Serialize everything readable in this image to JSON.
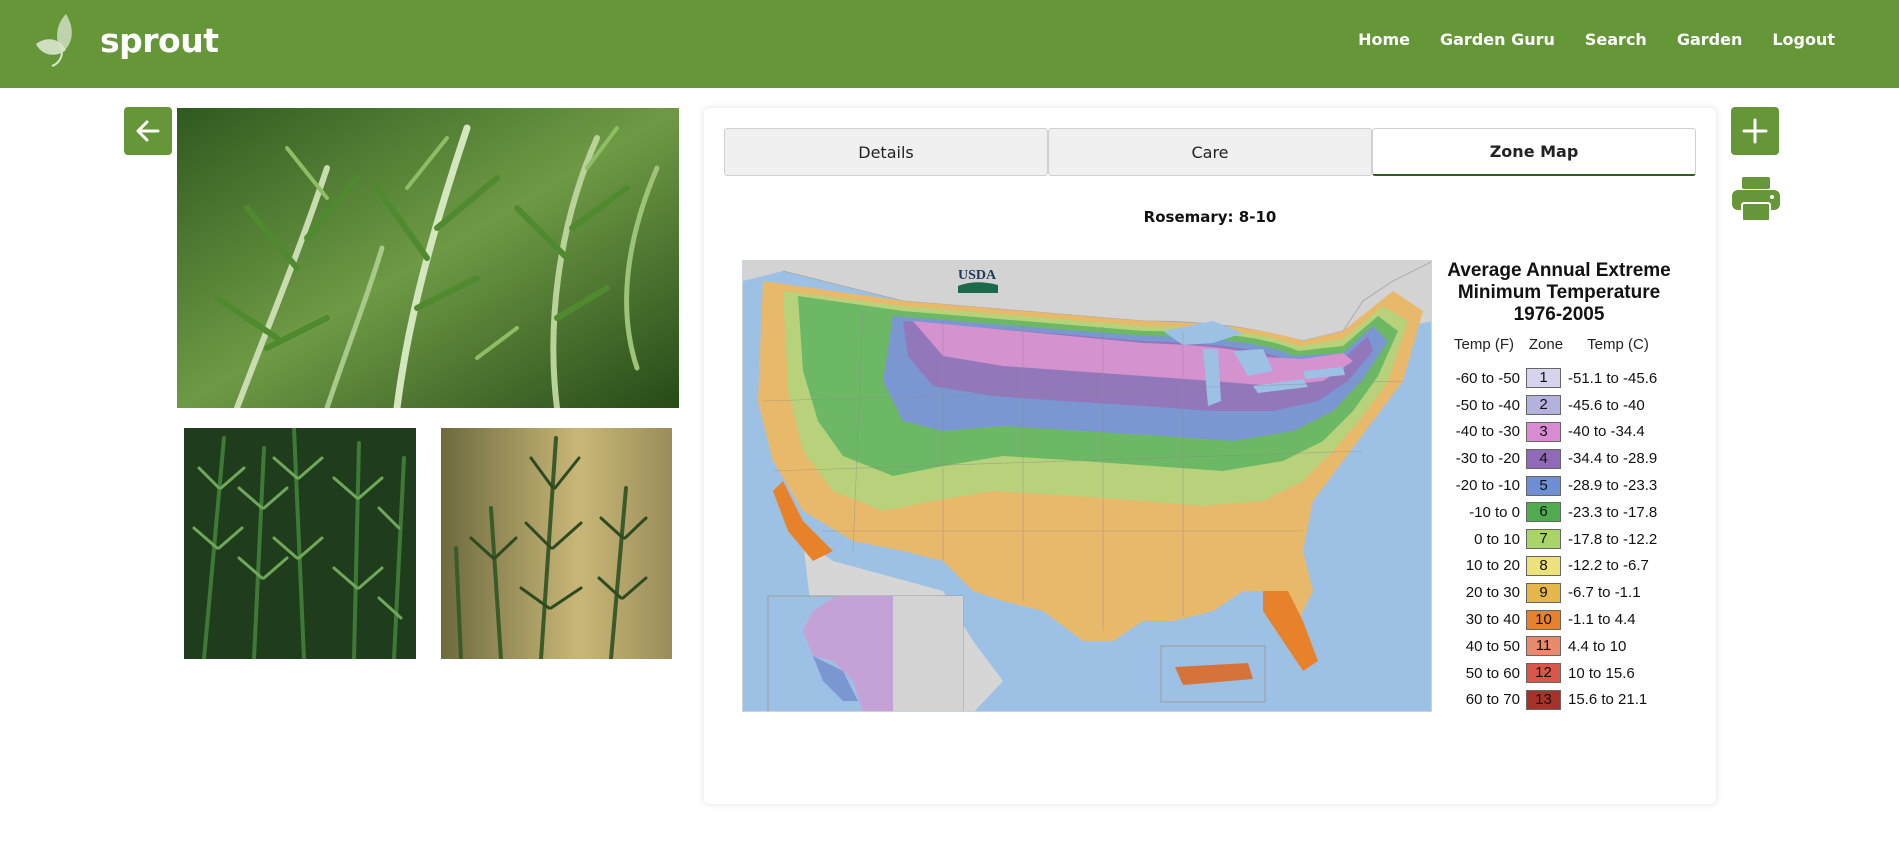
{
  "header": {
    "logo_text": "sprout",
    "nav": [
      {
        "label": "Home"
      },
      {
        "label": "Garden Guru"
      },
      {
        "label": "Search"
      },
      {
        "label": "Garden"
      },
      {
        "label": "Logout"
      }
    ]
  },
  "icons": {
    "back": "arrow-left-icon",
    "add": "plus-icon",
    "print": "printer-icon",
    "logo": "leaf-icon"
  },
  "colors": {
    "brand_green": "#659637",
    "active_tab_underline": "#2e5e1a"
  },
  "tabs": [
    {
      "label": "Details",
      "active": false
    },
    {
      "label": "Care",
      "active": false
    },
    {
      "label": "Zone Map",
      "active": true
    }
  ],
  "zone_heading": "Rosemary: 8-10",
  "map": {
    "agency_mark": "USDA",
    "legend": {
      "title_lines": [
        "Average Annual Extreme",
        "Minimum Temperature",
        "1976-2005"
      ],
      "col_f": "Temp (F)",
      "col_zone": "Zone",
      "col_c": "Temp (C)",
      "rows": [
        {
          "f": "-60 to -50",
          "zone": "1",
          "c": "-51.1 to -45.6",
          "color": "#d5d4ec"
        },
        {
          "f": "-50 to -40",
          "zone": "2",
          "c": "-45.6 to -40",
          "color": "#b3b1de"
        },
        {
          "f": "-40 to -30",
          "zone": "3",
          "c": "-40 to -34.4",
          "color": "#d88bd0"
        },
        {
          "f": "-30 to -20",
          "zone": "4",
          "c": "-34.4 to -28.9",
          "color": "#8e6ab8"
        },
        {
          "f": "-20 to -10",
          "zone": "5",
          "c": "-28.9 to -23.3",
          "color": "#6f8fd4"
        },
        {
          "f": "-10 to 0",
          "zone": "6",
          "c": "-23.3 to -17.8",
          "color": "#4fac4e"
        },
        {
          "f": "0 to 10",
          "zone": "7",
          "c": "-17.8 to -12.2",
          "color": "#a8d46a"
        },
        {
          "f": "10 to 20",
          "zone": "8",
          "c": "-12.2 to -6.7",
          "color": "#ede17c"
        },
        {
          "f": "20 to 30",
          "zone": "9",
          "c": "-6.7 to -1.1",
          "color": "#e5b64a"
        },
        {
          "f": "30 to 40",
          "zone": "10",
          "c": "-1.1 to 4.4",
          "color": "#e8822a"
        },
        {
          "f": "40 to 50",
          "zone": "11",
          "c": "4.4 to 10",
          "color": "#e98a6b"
        },
        {
          "f": "50 to 60",
          "zone": "12",
          "c": "10 to 15.6",
          "color": "#d8574a"
        },
        {
          "f": "60 to 70",
          "zone": "13",
          "c": "15.6 to 21.1",
          "color": "#a8322a"
        }
      ]
    }
  }
}
